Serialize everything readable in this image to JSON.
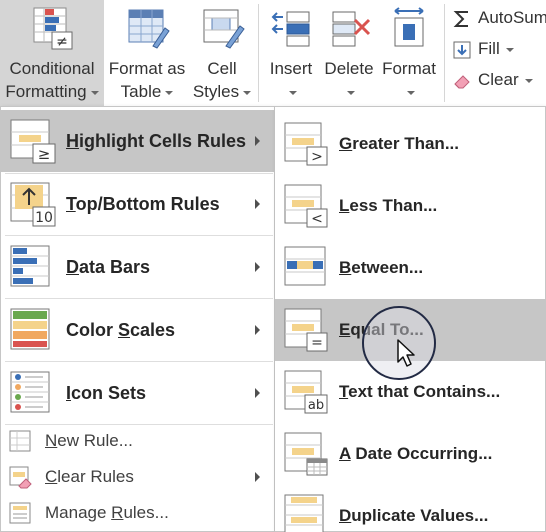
{
  "ribbon": {
    "conditional_formatting": {
      "line1": "Conditional",
      "line2": "Formatting"
    },
    "format_as_table": {
      "line1": "Format as",
      "line2": "Table"
    },
    "cell_styles": {
      "line1": "Cell",
      "line2": "Styles"
    },
    "insert": "Insert",
    "delete": "Delete",
    "format": "Format",
    "autosum": "AutoSum",
    "fill": "Fill",
    "clear": "Clear"
  },
  "menu": {
    "items": [
      {
        "pre": "",
        "key": "H",
        "post": "ighlight Cells Rules",
        "icon": "highlight-cells-icon"
      },
      {
        "pre": "",
        "key": "T",
        "post": "op/Bottom Rules",
        "icon": "top-bottom-icon"
      },
      {
        "pre": "",
        "key": "D",
        "post": "ata Bars",
        "icon": "data-bars-icon"
      },
      {
        "pre": "Color ",
        "key": "S",
        "post": "cales",
        "icon": "color-scales-icon"
      },
      {
        "pre": "",
        "key": "I",
        "post": "con Sets",
        "icon": "icon-sets-icon"
      }
    ],
    "small": [
      {
        "pre": "",
        "key": "N",
        "post": "ew Rule...",
        "icon": "new-rule-icon"
      },
      {
        "pre": "",
        "key": "C",
        "post": "lear Rules",
        "icon": "clear-rules-icon"
      },
      {
        "pre": "Manage ",
        "key": "R",
        "post": "ules...",
        "icon": "manage-rules-icon"
      }
    ]
  },
  "submenu": {
    "items": [
      {
        "pre": "",
        "key": "G",
        "post": "reater Than...",
        "icon": "greater-than-icon"
      },
      {
        "pre": "",
        "key": "L",
        "post": "ess Than...",
        "icon": "less-than-icon"
      },
      {
        "pre": "",
        "key": "B",
        "post": "etween...",
        "icon": "between-icon"
      },
      {
        "pre": "",
        "key": "E",
        "post": "qual To...",
        "icon": "equal-to-icon"
      },
      {
        "pre": "",
        "key": "T",
        "post": "ext that Contains...",
        "icon": "text-contains-icon"
      },
      {
        "pre": "",
        "key": "A",
        "post": " Date Occurring...",
        "icon": "date-occurring-icon"
      },
      {
        "pre": "",
        "key": "D",
        "post": "uplicate Values...",
        "icon": "duplicate-values-icon"
      }
    ]
  },
  "icon_text": {
    "ne": "≠",
    "gte": "≥",
    "ten": "10",
    "gt": ">",
    "lt": "<",
    "eq": "=",
    "ab": "ab"
  },
  "colors": {
    "hover": "#c6c6c6",
    "ribbon_active": "#d5d5d5",
    "highlight_fill": "#f4d38b",
    "accent_blue": "#3a6fb6",
    "accent_red": "#d9534f"
  }
}
